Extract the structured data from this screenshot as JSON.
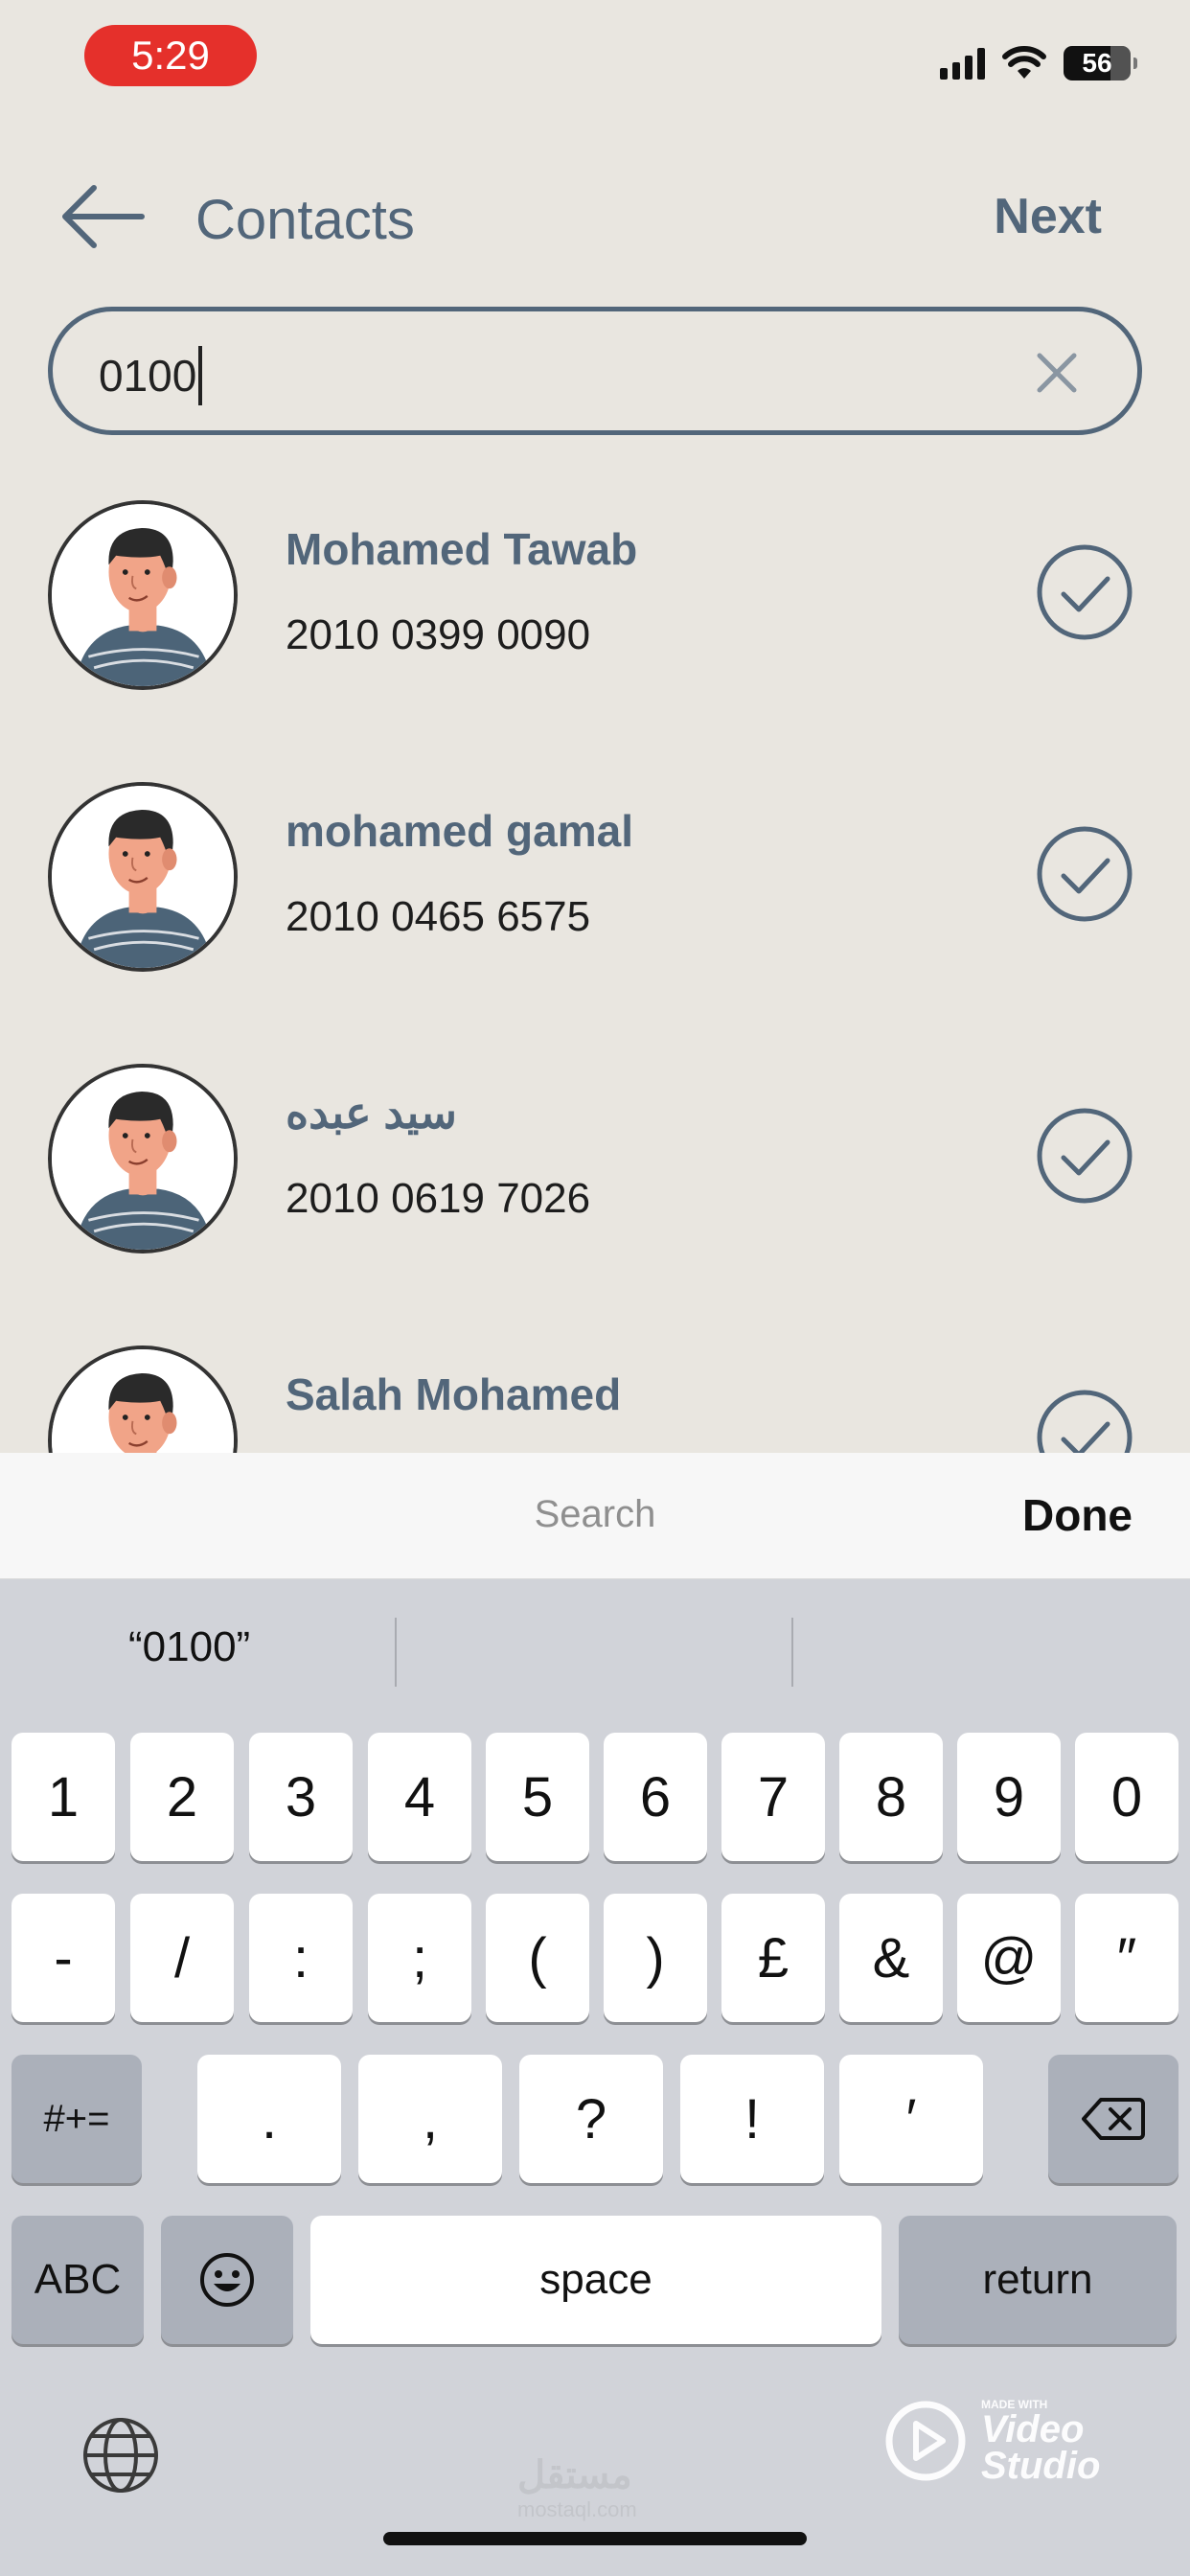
{
  "status_bar": {
    "time": "5:29",
    "battery": "56"
  },
  "header": {
    "title": "Contacts",
    "next_label": "Next"
  },
  "search": {
    "value": "0100"
  },
  "contacts": [
    {
      "name": "Mohamed Tawab",
      "phone": "2010 0399 0090"
    },
    {
      "name": "mohamed gamal",
      "phone": "2010 0465 6575"
    },
    {
      "name": "سيد عبده",
      "phone": "2010 0619 7026"
    },
    {
      "name": "Salah Mohamed",
      "phone": ""
    }
  ],
  "keyboard_accessory": {
    "placeholder": "Search",
    "done_label": "Done"
  },
  "keyboard": {
    "suggestion": "“0100”",
    "row1": [
      "1",
      "2",
      "3",
      "4",
      "5",
      "6",
      "7",
      "8",
      "9",
      "0"
    ],
    "row2": [
      "-",
      "/",
      ":",
      ";",
      "(",
      ")",
      "£",
      "&",
      "@",
      "″"
    ],
    "row3": [
      ".",
      ",",
      "?",
      "!",
      "′"
    ],
    "symbols_label": "#+=",
    "abc_label": "ABC",
    "space_label": "space",
    "return_label": "return"
  },
  "watermark": {
    "made_with": "MADE WITH",
    "line1": "Video",
    "line2": "Studio",
    "mostaql": "مستقل",
    "mostaql_sub": "mostaql.com"
  },
  "colors": {
    "accent": "#52667a",
    "background": "#e9e6e0",
    "time_pill": "#e5302b",
    "keyboard_bg": "#d1d3d9"
  },
  "icons": [
    "back-arrow-icon",
    "clear-x-icon",
    "avatar-icon",
    "check-circle-icon",
    "backspace-icon",
    "emoji-icon",
    "globe-icon",
    "mic-icon",
    "signal-icon",
    "wifi-icon",
    "battery-icon"
  ]
}
